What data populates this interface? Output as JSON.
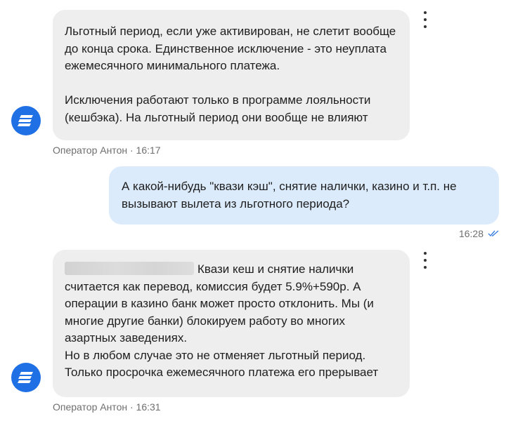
{
  "messages": [
    {
      "paragraphs": [
        "Льготный период, если уже активирован, не слетит вообще до конца срока. Единственное исключение - это неуплата ежемесячного минимального платежа.",
        "Исключения работают только в программе лояльности (кешбэка). На льготный период они вообще не влияют"
      ],
      "author": "Оператор Антон",
      "time": "16:17"
    },
    {
      "text": "А какой-нибудь \"квази кэш\", снятие налички, казино и т.п. не вызывают вылета из льготного периода?",
      "time": "16:28"
    },
    {
      "text": "Квази кеш и снятие налички считается как перевод, комиссия будет 5.9%+590р. А операции в казино банк может просто отклонить. Мы (и многие другие банки) блокируем работу во многих азартных заведениях.\nНо в любом случае это не отменяет льготный период. Только просрочка ежемесячного платежа его прерывает",
      "author": "Оператор Антон",
      "time": "16:31"
    }
  ],
  "colors": {
    "avatar": "#1f6fe5",
    "incoming_bubble": "#eeeeee",
    "outgoing_bubble": "#dcebfb",
    "read_check": "#3b7fe0"
  },
  "icons": {
    "avatar": "operator-logo-icon",
    "menu": "more-vertical-icon",
    "status": "double-check-icon"
  }
}
